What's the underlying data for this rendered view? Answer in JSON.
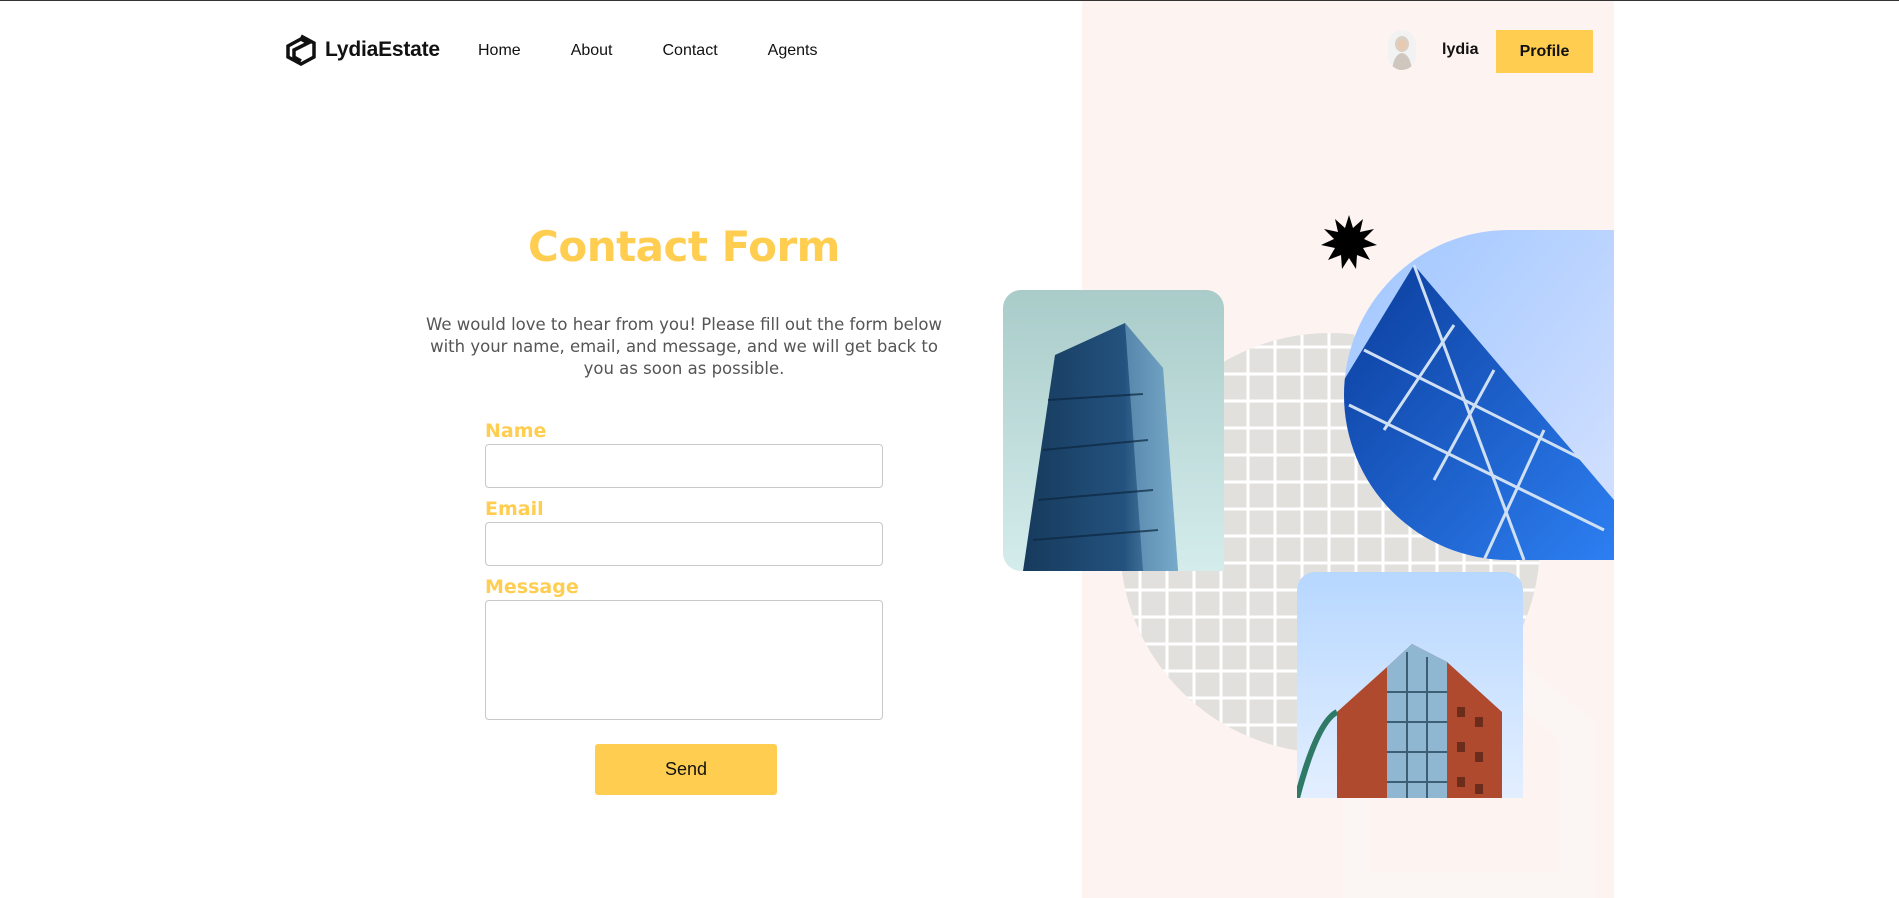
{
  "header": {
    "brand": "LydiaEstate",
    "nav": [
      "Home",
      "About",
      "Contact",
      "Agents"
    ],
    "username": "lydia",
    "profile_label": "Profile"
  },
  "contact": {
    "title": "Contact Form",
    "intro": "We would love to hear from you! Please fill out the form below with your name, email, and message, and we will get back to you as soon as possible.",
    "name_label": "Name",
    "email_label": "Email",
    "message_label": "Message",
    "send_label": "Send"
  },
  "colors": {
    "accent": "#ffcd50",
    "panel": "#fdf3f1"
  }
}
